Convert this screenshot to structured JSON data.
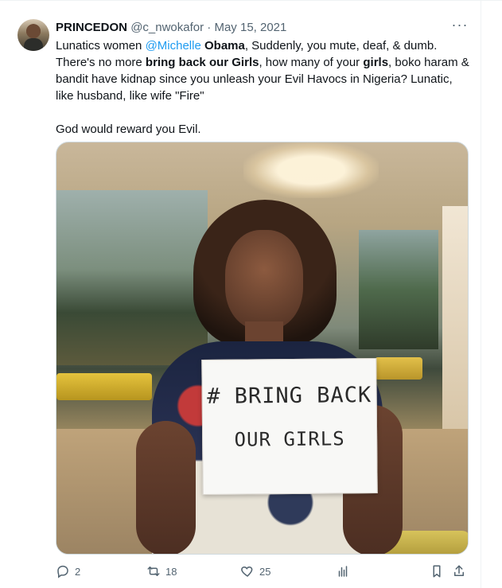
{
  "tweet": {
    "author": {
      "display_name": "PRINCEDON",
      "handle": "@c_nwokafor",
      "separator": "·",
      "date": "May 15, 2021"
    },
    "more_label": "···",
    "text": {
      "p1": [
        {
          "t": "Lunatics women "
        },
        {
          "t": "@Michelle",
          "kind": "mention"
        },
        {
          "t": " "
        },
        {
          "t": "Obama",
          "kind": "bold"
        },
        {
          "t": ", Suddenly, you mute, deaf, & dumb. There's no more "
        },
        {
          "t": "bring back our Girls",
          "kind": "bold"
        },
        {
          "t": ", how many of your "
        },
        {
          "t": "girls",
          "kind": "bold"
        },
        {
          "t": ", boko haram & bandit have kidnap since you unleash your Evil Havocs in Nigeria? Lunatic, like husband, like wife \"Fire\""
        }
      ],
      "p2": "God would reward you Evil."
    },
    "media": {
      "sign_line1": "# BRING BACK",
      "sign_line2": "OUR GIRLS"
    },
    "actions": {
      "reply_count": "2",
      "retweet_count": "18",
      "like_count": "25"
    }
  },
  "colors": {
    "text_primary": "#0f1419",
    "text_secondary": "#536471",
    "link_blue": "#1d9bf0",
    "divider": "#eff3f4"
  },
  "icons": {
    "reply": "speech-bubble-icon",
    "retweet": "retweet-arrows-icon",
    "like": "heart-icon",
    "views": "bar-chart-icon",
    "bookmark": "bookmark-icon",
    "share": "share-arrow-up-icon"
  }
}
